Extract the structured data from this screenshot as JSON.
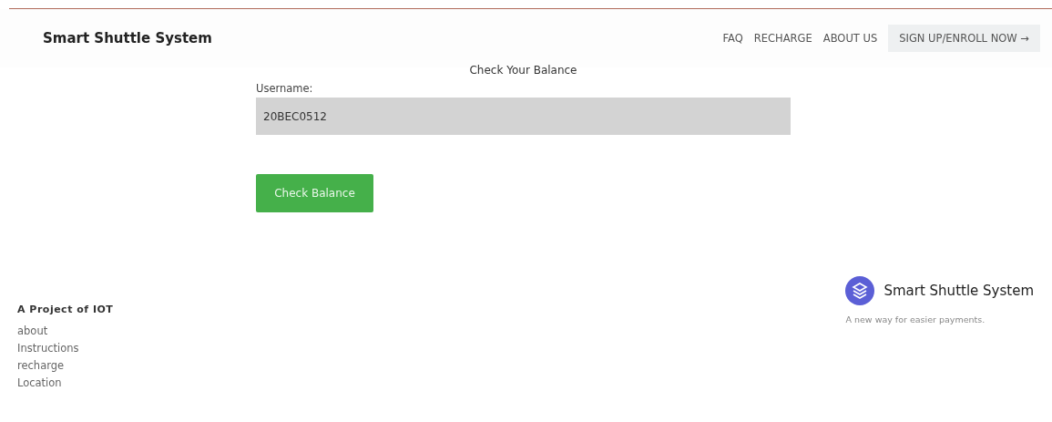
{
  "header": {
    "brand": "Smart Shuttle System",
    "nav": [
      {
        "label": "FAQ",
        "kind": "link"
      },
      {
        "label": "RECHARGE",
        "kind": "link"
      },
      {
        "label": "ABOUT US",
        "kind": "link"
      },
      {
        "label": "SIGN UP/ENROLL NOW →",
        "kind": "cta"
      }
    ]
  },
  "form": {
    "title": "Check Your Balance",
    "label": "Username:",
    "value": "20BEC0512",
    "button": "Check Balance"
  },
  "footer": {
    "heading": "A Project of IOT",
    "links": [
      "about",
      "Instructions",
      "recharge",
      "Location"
    ],
    "brand": "Smart Shuttle System",
    "tagline": "A new way for easier payments."
  }
}
